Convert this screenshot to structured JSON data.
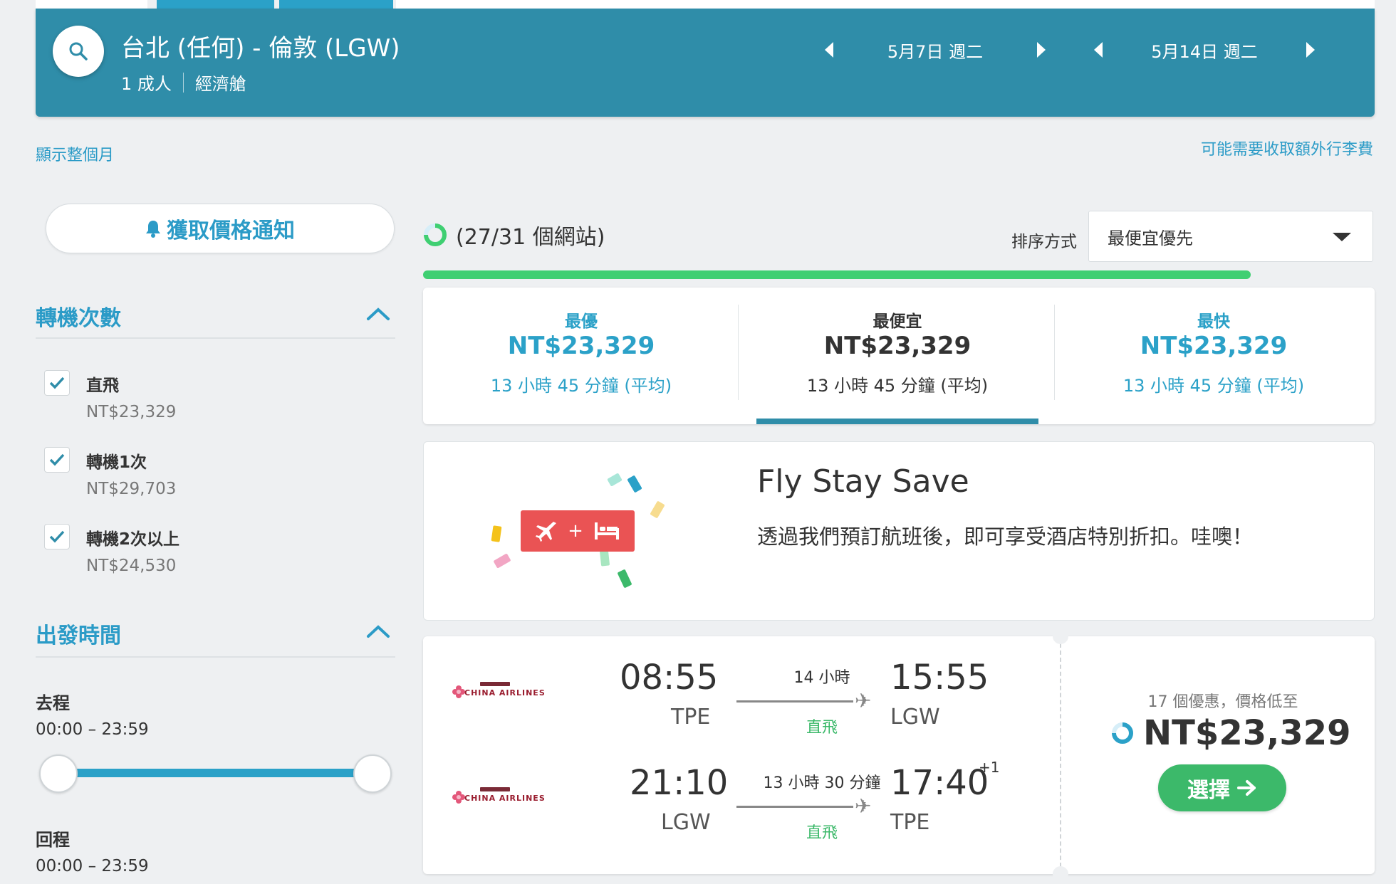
{
  "header": {
    "route": "台北 (任何) - 倫敦 (LGW)",
    "passengers": "1 成人",
    "cabin": "經濟艙",
    "depart_date": "5月7日 週二",
    "return_date": "5月14日 週二"
  },
  "links": {
    "show_month": "顯示整個月",
    "luggage": "可能需要收取額外行李費"
  },
  "alert_button": "獲取價格通知",
  "stops_filter": {
    "title": "轉機次數",
    "items": [
      {
        "label": "直飛",
        "price": "NT$23,329",
        "checked": true
      },
      {
        "label": "轉機1次",
        "price": "NT$29,703",
        "checked": true
      },
      {
        "label": "轉機2次以上",
        "price": "NT$24,530",
        "checked": true
      }
    ]
  },
  "time_filter": {
    "title": "出發時間",
    "outbound_label": "去程",
    "outbound_range": "00:00 – 23:59",
    "return_label": "回程",
    "return_range": "00:00 – 23:59"
  },
  "progress": {
    "text": "(27/31 個網站)",
    "fraction": 0.87
  },
  "sort": {
    "label": "排序方式",
    "value": "最便宜優先"
  },
  "summary": [
    {
      "label": "最優",
      "price": "NT$23,329",
      "duration": "13 小時 45 分鐘 (平均)"
    },
    {
      "label": "最便宜",
      "price": "NT$23,329",
      "duration": "13 小時 45 分鐘 (平均)"
    },
    {
      "label": "最快",
      "price": "NT$23,329",
      "duration": "13 小時 45 分鐘 (平均)"
    }
  ],
  "promo": {
    "title": "Fly Stay Save",
    "text": "透過我們預訂航班後，即可享受酒店特別折扣。哇噢！",
    "badge_plus": "+"
  },
  "result": {
    "outbound": {
      "airline": "CHINA AIRLINES",
      "dep_time": "08:55",
      "dep_code": "TPE",
      "duration": "14 小時",
      "stops": "直飛",
      "arr_time": "15:55",
      "arr_code": "LGW"
    },
    "inbound": {
      "airline": "CHINA AIRLINES",
      "dep_time": "21:10",
      "dep_code": "LGW",
      "duration": "13 小時 30 分鐘",
      "stops": "直飛",
      "arr_time": "17:40",
      "arr_plus": "+1",
      "arr_code": "TPE"
    },
    "deals": "17 個優惠，價格低至",
    "price": "NT$23,329",
    "select_label": "選擇"
  },
  "colors": {
    "header_bg": "#2f8da9",
    "accent_blue": "#2ba1c8",
    "green": "#3cb96a",
    "progress_green": "#3fcf72",
    "promo_red": "#ea5354"
  }
}
